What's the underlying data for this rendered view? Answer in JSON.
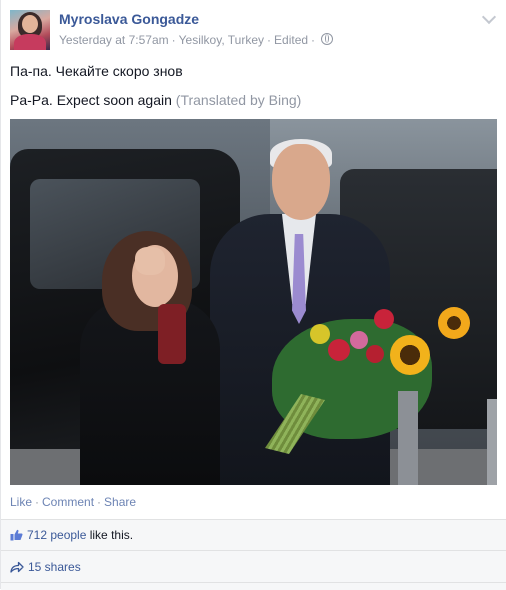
{
  "post": {
    "author": "Myroslava Gongadze",
    "timestamp": "Yesterday at 7:57am",
    "location": "Yesilkoy, Turkey",
    "edited": "Edited",
    "text_original": "Па-па. Чекайте скоро знов",
    "text_translated": "Pa-Pa. Expect soon again",
    "translated_by": "(Translated by Bing)"
  },
  "actions": {
    "like": "Like",
    "comment": "Comment",
    "share": "Share"
  },
  "feedback": {
    "likes_link": "712 people",
    "likes_suffix": " like this.",
    "shares": "15 shares"
  },
  "icons": {
    "privacy": "globe-icon",
    "menu": "chevron-down-icon",
    "like": "thumbs-up-icon",
    "share": "share-arrow-icon"
  },
  "colors": {
    "link": "#3b5998",
    "muted": "#9197a3",
    "feedback_bg": "#f6f7f8"
  }
}
